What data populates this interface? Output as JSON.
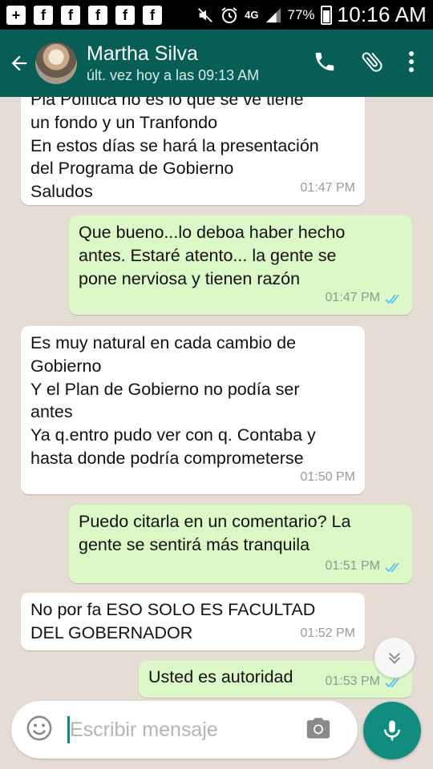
{
  "status_bar": {
    "battery": "77%",
    "network": "4G",
    "time": "10:16 AM",
    "notification_icons": [
      "add-box-icon",
      "facebook-icon",
      "facebook-icon",
      "facebook-icon",
      "facebook-icon",
      "facebook-icon"
    ]
  },
  "header": {
    "contact_name": "Martha Silva",
    "last_seen": "últ. vez hoy a las 09:13 AM"
  },
  "messages": [
    {
      "direction": "in",
      "text": "Pla Política no es lo que se ve tiene\nun fondo y un Tranfondo\nEn estos días se hará la presentación\ndel Programa de Gobierno\nSaludos",
      "time": "01:47 PM"
    },
    {
      "direction": "out",
      "text": "Que bueno...lo deboa haber hecho\nantes. Estaré atento... la gente se\npone nerviosa y tienen razón",
      "time": "01:47 PM",
      "status": "read"
    },
    {
      "direction": "in",
      "text": "Es muy natural en cada cambio de\nGobierno\nY el Plan de Gobierno no podía ser\nantes\nYa q.entro pudo ver con q. Contaba y\nhasta donde podría comprometerse",
      "time": "01:50 PM"
    },
    {
      "direction": "out",
      "text": "Puedo citarla en un comentario? La\ngente se sentirá más tranquila",
      "time": "01:51 PM",
      "status": "read"
    },
    {
      "direction": "in",
      "text": "No por fa ESO SOLO ES FACULTAD\nDEL GOBERNADOR",
      "time": "01:52 PM"
    },
    {
      "direction": "out",
      "text": "Usted es autoridad",
      "time": "01:53 PM",
      "status": "read"
    }
  ],
  "composer": {
    "placeholder": "Escribir mensaje"
  },
  "colors": {
    "header": "#075e54",
    "incoming_bubble": "#ffffff",
    "outgoing_bubble": "#dcf8c6",
    "accent": "#128c7e",
    "read_ticks": "#4fc3f7",
    "chat_background": "#e5ddd5"
  }
}
